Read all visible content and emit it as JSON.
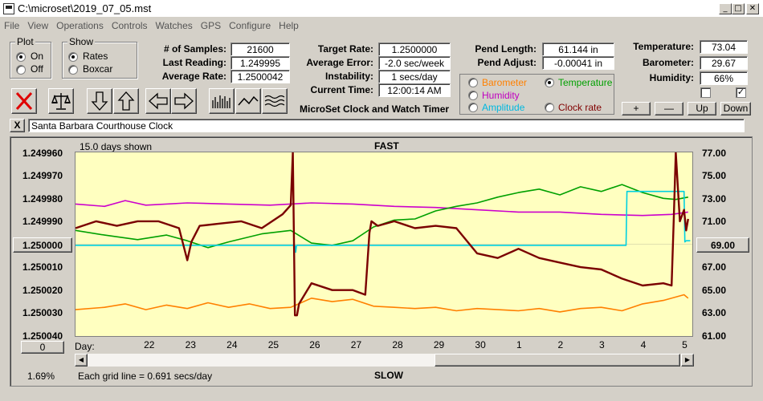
{
  "window": {
    "title": "C:\\microset\\2019_07_05.mst"
  },
  "menu": [
    "File",
    "View",
    "Operations",
    "Controls",
    "Watches",
    "GPS",
    "Configure",
    "Help"
  ],
  "plot_group": {
    "label": "Plot",
    "options": [
      "On",
      "Off"
    ],
    "selected": "On"
  },
  "show_group": {
    "label": "Show",
    "options": [
      "Rates",
      "Boxcar"
    ],
    "selected": "Rates"
  },
  "stats": {
    "samples_label": "# of Samples:",
    "samples": "21600",
    "last_reading_label": "Last Reading:",
    "last_reading": "1.249995",
    "average_rate_label": "Average Rate:",
    "average_rate": "1.2500042"
  },
  "rates": {
    "target_rate_label": "Target Rate:",
    "target_rate": "1.2500000",
    "average_error_label": "Average Error:",
    "average_error": "-2.0 sec/week",
    "instability_label": "Instability:",
    "instability": "1 secs/day",
    "current_time_label": "Current Time:",
    "current_time": "12:00:14 AM"
  },
  "pend": {
    "length_label": "Pend Length:",
    "length": "61.144 in",
    "adjust_label": "Pend Adjust:",
    "adjust": "-0.00041 in"
  },
  "env": {
    "temperature_label": "Temperature:",
    "temperature": "73.04",
    "barometer_label": "Barometer:",
    "barometer": "29.67",
    "humidity_label": "Humidity:",
    "humidity": "66%"
  },
  "overlay_options": {
    "items": [
      {
        "label": "Barometer",
        "color": "#ff8000",
        "selected": false
      },
      {
        "label": "Temperature",
        "color": "#00a000",
        "selected": true
      },
      {
        "label": "Humidity",
        "color": "#c000c0",
        "selected": false
      },
      {
        "label": "Amplitude",
        "color": "#00c0e0",
        "selected": false
      },
      {
        "label": "Clock rate",
        "color": "#800000",
        "selected": false
      }
    ]
  },
  "app_caption": "MicroSet Clock and Watch Timer",
  "scale_buttons": {
    "plus": "+",
    "minus": "—",
    "up": "Up",
    "down": "Down"
  },
  "checkboxes": {
    "left": false,
    "right": true
  },
  "clock_name": "Santa Barbara Courthouse Clock",
  "close_x": "X",
  "chart": {
    "days_shown": "15.0 days shown",
    "fast_label": "FAST",
    "slow_label": "SLOW",
    "day_label": "Day:",
    "grid_note": "Each grid line = 0.691 secs/day",
    "left_button": "1.250000",
    "right_button": "69.00",
    "bottom_left_button": "0",
    "percent": "1.69%"
  },
  "chart_data": {
    "type": "line",
    "xlabel": "Day:",
    "x_ticks": [
      "22",
      "23",
      "24",
      "25",
      "26",
      "27",
      "28",
      "29",
      "30",
      "1",
      "2",
      "3",
      "4",
      "5"
    ],
    "y_left_ticks": [
      "1.249960",
      "1.249970",
      "1.249980",
      "1.249990",
      "1.250000",
      "1.250010",
      "1.250020",
      "1.250030",
      "1.250040"
    ],
    "y_right_ticks": [
      "77.00",
      "75.00",
      "73.00",
      "71.00",
      "69.00",
      "67.00",
      "65.00",
      "63.00",
      "61.00"
    ],
    "ylim_left": [
      1.24996,
      1.25004
    ],
    "ylim_right": [
      61,
      77
    ],
    "x_range": [
      21.3,
      36.2
    ],
    "series": [
      {
        "name": "Humidity",
        "color": "#cc00cc",
        "axis": "right",
        "x": [
          21.3,
          22.0,
          22.5,
          23.0,
          24.0,
          25.0,
          26.0,
          27.0,
          28.0,
          29.0,
          30.0,
          31.0,
          32.0,
          33.0,
          34.0,
          35.0,
          35.7,
          36.1
        ],
        "y": [
          72.5,
          72.3,
          72.8,
          72.4,
          72.6,
          72.5,
          72.4,
          72.6,
          72.5,
          72.3,
          72.2,
          72.0,
          71.8,
          71.8,
          71.6,
          71.5,
          71.6,
          71.8
        ]
      },
      {
        "name": "Temperature",
        "color": "#00a000",
        "axis": "right",
        "x": [
          21.3,
          22.0,
          22.8,
          23.5,
          24.0,
          24.5,
          25.0,
          25.8,
          26.5,
          27.0,
          27.5,
          28.0,
          28.5,
          29.0,
          29.5,
          30.0,
          30.5,
          31.0,
          31.5,
          32.0,
          32.5,
          33.0,
          33.5,
          34.0,
          34.5,
          35.0,
          35.5,
          35.8,
          36.1
        ],
        "y": [
          70.2,
          69.8,
          69.4,
          69.8,
          69.3,
          68.7,
          69.2,
          69.9,
          70.2,
          69.1,
          68.9,
          69.3,
          70.5,
          71.1,
          71.2,
          71.9,
          72.3,
          72.6,
          73.1,
          73.5,
          73.8,
          73.3,
          74.0,
          73.6,
          74.2,
          73.5,
          73.0,
          72.9,
          73.1
        ]
      },
      {
        "name": "Amplitude",
        "color": "#00d0e0",
        "axis": "right",
        "x": [
          21.3,
          26.6,
          26.62,
          26.64,
          34.6,
          34.62,
          36.0,
          36.02,
          36.05,
          36.15
        ],
        "y": [
          68.9,
          68.9,
          68.3,
          68.9,
          68.9,
          73.6,
          73.6,
          69.2,
          69.3,
          69.3
        ]
      },
      {
        "name": "Barometer",
        "color": "#ff8000",
        "axis": "right",
        "x": [
          21.3,
          22.0,
          22.5,
          23.0,
          23.5,
          24.0,
          24.5,
          25.0,
          25.5,
          26.0,
          26.5,
          27.0,
          27.5,
          28.0,
          28.5,
          29.0,
          29.5,
          30.0,
          30.5,
          31.0,
          31.5,
          32.0,
          32.5,
          33.0,
          33.5,
          34.0,
          34.5,
          35.0,
          35.5,
          36.0,
          36.1
        ],
        "y": [
          63.3,
          63.5,
          63.8,
          63.3,
          63.7,
          63.4,
          63.9,
          63.5,
          63.8,
          63.4,
          63.5,
          64.3,
          64.0,
          64.2,
          63.6,
          63.5,
          63.4,
          63.5,
          63.2,
          63.4,
          63.3,
          63.2,
          63.4,
          63.1,
          63.4,
          63.5,
          63.2,
          63.8,
          64.1,
          64.6,
          64.3
        ]
      },
      {
        "name": "Clock rate",
        "color": "#7a0000",
        "axis": "left",
        "x": [
          21.3,
          21.8,
          22.3,
          22.8,
          23.3,
          23.8,
          24.0,
          24.1,
          24.3,
          24.8,
          25.3,
          25.8,
          26.3,
          26.5,
          26.55,
          26.6,
          26.65,
          26.7,
          27.0,
          27.5,
          28.0,
          28.3,
          28.4,
          28.45,
          28.6,
          29.0,
          29.5,
          30.0,
          30.5,
          31.0,
          31.5,
          32.0,
          32.5,
          33.0,
          33.5,
          34.0,
          34.5,
          35.0,
          35.5,
          35.7,
          35.75,
          35.8,
          35.9,
          36.0,
          36.05,
          36.1
        ],
        "y": [
          1.249993,
          1.24999,
          1.249992,
          1.24999,
          1.24999,
          1.249993,
          1.250007,
          1.249999,
          1.249992,
          1.249991,
          1.24999,
          1.249993,
          1.249987,
          1.249983,
          1.24996,
          1.250031,
          1.250031,
          1.250026,
          1.250017,
          1.25002,
          1.25002,
          1.250022,
          1.249995,
          1.24999,
          1.249992,
          1.24999,
          1.249993,
          1.249992,
          1.249993,
          1.250004,
          1.250006,
          1.250002,
          1.250006,
          1.250008,
          1.25001,
          1.250011,
          1.250015,
          1.250018,
          1.250017,
          1.250018,
          1.24999,
          1.24996,
          1.24999,
          1.249985,
          1.249994,
          1.249989
        ]
      }
    ]
  }
}
